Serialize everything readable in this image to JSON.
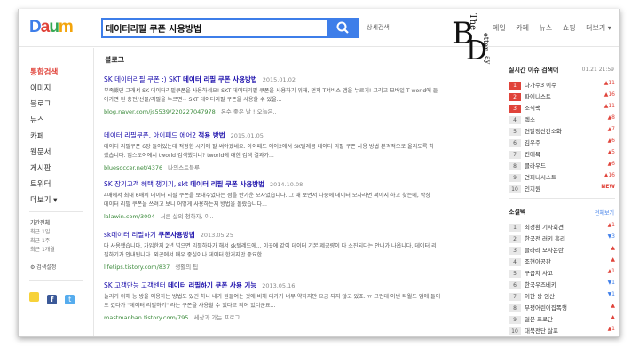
{
  "header": {
    "logo_text": "Daum",
    "search_value": "데이터리필 쿠폰 사용방법",
    "detail_search_label": "상세검색",
    "nav_items": [
      "메일",
      "카페",
      "뉴스",
      "쇼핑",
      "더보기 ▾"
    ]
  },
  "stamp": {
    "line1": "The",
    "line2": "B",
    "line3": "etter",
    "line4": "D",
    "line5": "ay"
  },
  "sidebar": {
    "items": [
      "통합검색",
      "이미지",
      "블로그",
      "뉴스",
      "카페",
      "웹문서",
      "게시판",
      "트위터",
      "더보기 ▾"
    ],
    "periods": [
      "기간전체",
      "최근 1일",
      "최근 1주",
      "최근 1개월"
    ],
    "settings_label": "⚙ 검색설정"
  },
  "main": {
    "section_title": "블로그",
    "results": [
      {
        "title_pre": "SK 데이터리필 쿠폰 :) SKT ",
        "title_bold": "데이터 리필 쿠폰 사용방법",
        "date": "2015.01.02",
        "desc_line1": "부족했던 그래서 SK 데이터리필쿠폰을 사용하세요! SKT 데이터리필 쿠폰을 사용하기 위해, 먼저 T서비스 앱을 누르기! 그리고 모바일 T world에 들",
        "desc_line2": "어가면 된 충전/선물/리필을 누르면~ SKT 데이터리필 쿠폰을 사용할 수 있을...",
        "url": "blog.naver.com/js5539/220227047978",
        "source": "온수 좋은 날 ! 오늘은.."
      },
      {
        "title_pre": "데이터 리필쿠폰, 아이패드 에어2 ",
        "title_bold": "적용 방법",
        "date": "2015.01.05",
        "desc_line1": "데이터 리필쿠폰 6장 들어있는데 적정한 시기에 잘 써야겠네요. 아이패드 에어2에서 SK텔레콤 데이터 리필 쿠폰 사용 방법 본격적으로 올리도록 하",
        "desc_line2": "겠습니다. 앱스토어에서 tworld 검색했더니? tworld에 대한 검색 결과가...",
        "url": "bluesoccer.net/4376",
        "source": "나의스트블루"
      },
      {
        "title_pre": "SK 장기고객 혜택 챙기기, skt ",
        "title_bold": "데이터 리필 쿠폰 사용방법",
        "date": "2014.10.08",
        "desc_line1": "4매에서 최대 6매의 데이터 리필 쿠폰을 보내주었다는 점을 반가운 모자었습니다. 그 때 보면서 나중에 데이터 모자라면 써야지 하고 찾는데, 막상",
        "desc_line2": "데이터 리필 쿠폰을 쓰려고 보니 어떻게 사용하는지 방법을 몰랐습니다...",
        "url": "lalawin.com/3004",
        "source": "서른 살의 청하자, 이.."
      },
      {
        "title_pre": "sk데이터 리필하기 ",
        "title_bold": "쿠폰사용방법",
        "date": "2013.05.25",
        "desc_line1": "다 사용했습니다. 가입한지 2년 넘으면 리필하다가 해서 sk텔레드에... 이곳에 같이 데이터 기본 제공량이 다 소진되다는 안내가 나옵니다. 데이터 리",
        "desc_line2": "필하기가 안내됩니다. 외곤에서 매우 중심이나 데이터 한거지만 중요한...",
        "url": "lifetips.tistory.com/837",
        "source": "생활의 팁"
      },
      {
        "title_pre": "SK 고객만능 고객센터 ",
        "title_bold": "데이터 리필하기 쿠폰 사용 기능",
        "date": "2013.05.16",
        "desc_line1": "늘리기 위해 능 방을 이용하는 방법도 있긴 하나 내가 원들여는 것에 비해 대가가 너무 약하지만 요금 되지 않고 있죠. ㅠ 그런데 이번 티월드 앱에 들어",
        "desc_line2": "오 갔다가 \"데이터 리필하기\" 라는 쿠폰을 사용할 수 있다고 되어 있더군요...",
        "url": "mastmanban.tistory.com/795",
        "source": "세상과 가는 프로그.."
      }
    ]
  },
  "realtime": {
    "title": "실시간 이슈 검색어",
    "time": "01.21  21:59",
    "items": [
      {
        "rank": "1",
        "term": "나가수3 이수",
        "change": "▲11",
        "dir": "up"
      },
      {
        "rank": "2",
        "term": "파이니스트",
        "change": "▲16",
        "dir": "up"
      },
      {
        "rank": "3",
        "term": "소식팩",
        "change": "▲11",
        "dir": "up"
      },
      {
        "rank": "4",
        "term": "렉소",
        "change": "▲8",
        "dir": "up"
      },
      {
        "rank": "5",
        "term": "연말정산간소화",
        "change": "▲7",
        "dir": "up"
      },
      {
        "rank": "6",
        "term": "김우주",
        "change": "▲6",
        "dir": "up"
      },
      {
        "rank": "7",
        "term": "킨테목",
        "change": "▲5",
        "dir": "up"
      },
      {
        "rank": "8",
        "term": "클라우드",
        "change": "▲6",
        "dir": "up"
      },
      {
        "rank": "9",
        "term": "언피니시스트",
        "change": "▲16",
        "dir": "up"
      },
      {
        "rank": "10",
        "term": "인지원",
        "change": "NEW",
        "dir": "new"
      }
    ]
  },
  "novels": {
    "title": "소설텍",
    "more": "전체보기",
    "items": [
      {
        "rank": "1",
        "term": "최경환 기자회견",
        "change": "▲1",
        "dir": "up"
      },
      {
        "rank": "2",
        "term": "한국전 러키 흥리",
        "change": "▼3",
        "dir": "down"
      },
      {
        "rank": "3",
        "term": "클라라 모자논란",
        "change": "▲",
        "dir": "up"
      },
      {
        "rank": "4",
        "term": "조현아공판",
        "change": "▲",
        "dir": "up"
      },
      {
        "rank": "5",
        "term": "구급차 사고",
        "change": "▲1",
        "dir": "up"
      },
      {
        "rank": "6",
        "term": "한국우즈베키",
        "change": "▼1",
        "dir": "down"
      },
      {
        "rank": "7",
        "term": "이한 쌍 임산",
        "change": "▼1",
        "dir": "down"
      },
      {
        "rank": "8",
        "term": "부평어린이집폭행",
        "change": "▲",
        "dir": "up"
      },
      {
        "rank": "9",
        "term": "일본 프로단",
        "change": "▲",
        "dir": "up"
      },
      {
        "rank": "10",
        "term": "대북전단 살포",
        "change": "▲1",
        "dir": "up"
      }
    ]
  }
}
